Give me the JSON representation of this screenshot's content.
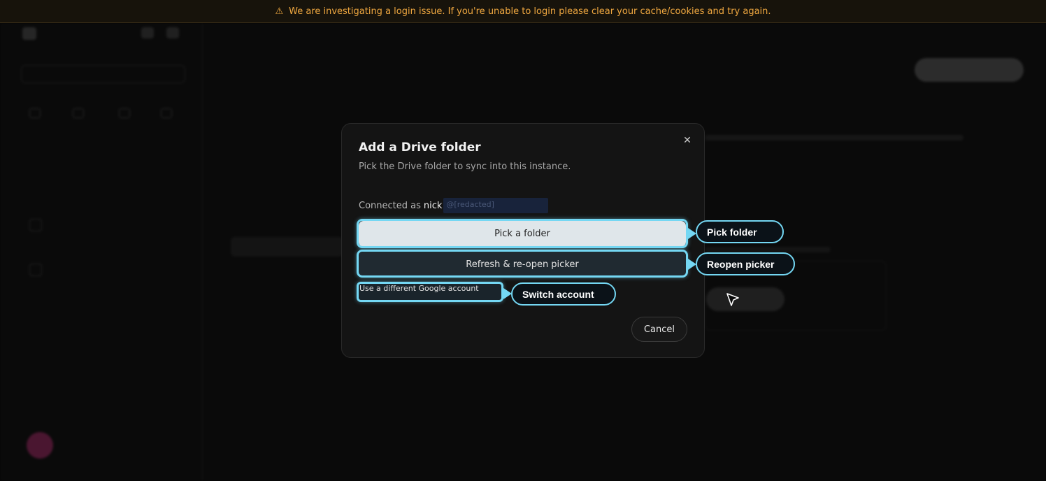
{
  "banner": {
    "icon": "warning-icon",
    "text": "We are investigating a login issue. If you're unable to login please clear your cache/cookies and try again.",
    "color": "#f0a840"
  },
  "modal": {
    "title": "Add a Drive folder",
    "description": "Pick the Drive folder to sync into this instance.",
    "connected_label": "Connected as",
    "connected_user": "nick",
    "connected_user_redacted": "@[redacted]",
    "buttons": {
      "pick_folder": "Pick a folder",
      "refresh_picker": "Refresh & re-open picker",
      "switch_account": "Use a different Google account",
      "cancel": "Cancel"
    }
  },
  "annotations": [
    {
      "label": "Pick folder",
      "target": "pick_folder"
    },
    {
      "label": "Reopen picker",
      "target": "refresh_picker"
    },
    {
      "label": "Switch account",
      "target": "switch_account"
    }
  ],
  "accent_color": "#74d7f3"
}
